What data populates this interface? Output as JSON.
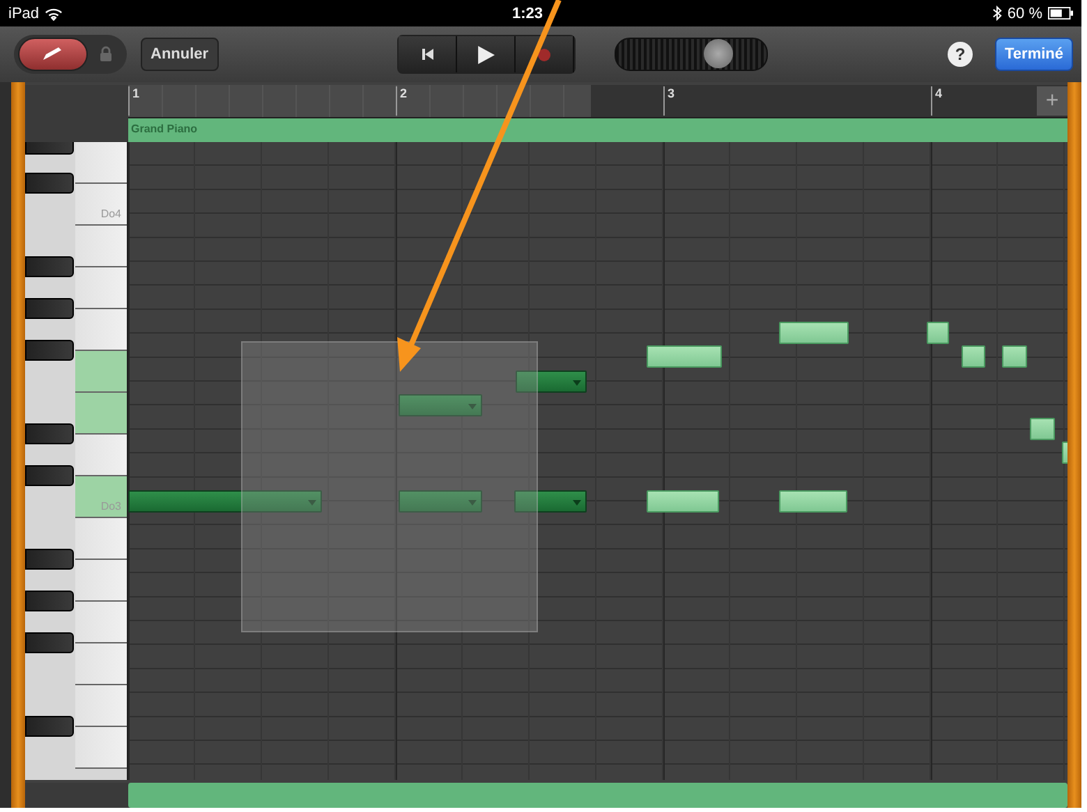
{
  "status_bar": {
    "device": "iPad",
    "time": "1:23",
    "battery": "60 %"
  },
  "toolbar": {
    "undo": "Annuler",
    "done": "Terminé",
    "help": "?",
    "pencil": {
      "on": true
    }
  },
  "ruler": {
    "bars": [
      "1",
      "2",
      "3",
      "4"
    ],
    "add": "+"
  },
  "track": {
    "name": "Grand Piano"
  },
  "volume": {
    "level": 0.72
  },
  "keys": [
    {
      "highlighted": false
    },
    {
      "label": "Do4",
      "highlighted": false
    },
    {
      "highlighted": false
    },
    {
      "highlighted": false
    },
    {
      "highlighted": false
    },
    {
      "highlighted": true
    },
    {
      "highlighted": true
    },
    {
      "highlighted": false
    },
    {
      "label": "Do3",
      "highlighted": true
    },
    {
      "highlighted": false
    },
    {
      "highlighted": false
    },
    {
      "highlighted": false
    },
    {
      "highlighted": false
    },
    {
      "highlighted": false
    },
    {
      "highlighted": false
    }
  ],
  "notes": [
    {
      "selected": true
    },
    {
      "selected": true
    },
    {
      "selected": true
    },
    {
      "selected": true
    },
    {
      "selected": true
    },
    {
      "selected": false
    },
    {
      "selected": false
    },
    {
      "selected": false
    },
    {
      "selected": false
    },
    {
      "selected": false
    },
    {
      "selected": false
    },
    {
      "selected": false
    },
    {
      "selected": false
    },
    {
      "selected": false
    }
  ]
}
